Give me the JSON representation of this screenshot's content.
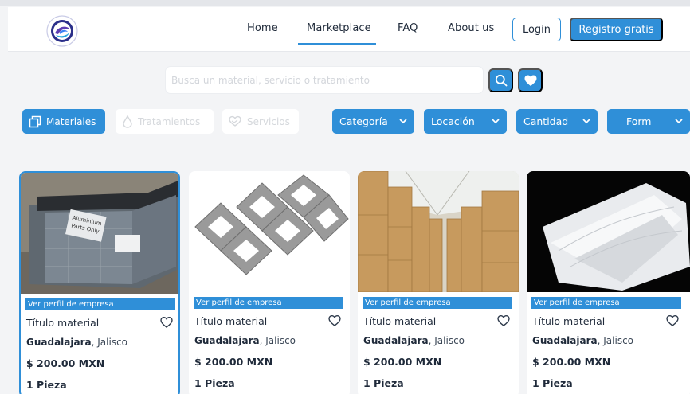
{
  "nav": {
    "items": [
      {
        "label": "Home"
      },
      {
        "label": "Marketplace",
        "active": true
      },
      {
        "label": "FAQ"
      },
      {
        "label": "About us"
      }
    ],
    "login_label": "Login",
    "register_label": "Registro gratis"
  },
  "search": {
    "placeholder": "Busca un material, servicio o tratamiento",
    "search_icon": "search-icon",
    "favorites_icon": "heart-icon"
  },
  "filters": {
    "types": [
      {
        "label": "Materiales",
        "icon": "copy-icon",
        "active": true
      },
      {
        "label": "Tratamientos",
        "icon": "drop-icon",
        "active": false
      },
      {
        "label": "Servicios",
        "icon": "heart-hand-icon",
        "active": false
      }
    ],
    "dropdowns": [
      {
        "label": "Categoría"
      },
      {
        "label": "Locación"
      },
      {
        "label": "Cantidad"
      },
      {
        "label": "Form"
      }
    ]
  },
  "cards": [
    {
      "profile_label": "Ver perfil de empresa",
      "title": "Título material",
      "city": "Guadalajara",
      "state": ", Jalisco",
      "price": "$ 200.00",
      "currency": "MXN",
      "quantity": "1 Pieza",
      "image_text": "Aluminium Parts Only..."
    },
    {
      "profile_label": "Ver perfil de empresa",
      "title": "Título material",
      "city": "Guadalajara",
      "state": ", Jalisco",
      "price": "$ 200.00",
      "currency": "MXN",
      "quantity": "1 Pieza"
    },
    {
      "profile_label": "Ver perfil de empresa",
      "title": "Título material",
      "city": "Guadalajara",
      "state": ", Jalisco",
      "price": "$ 200.00",
      "currency": "MXN",
      "quantity": "1 Pieza"
    },
    {
      "profile_label": "Ver perfil de empresa",
      "title": "Título material",
      "city": "Guadalajara",
      "state": ", Jalisco",
      "price": "$ 200.00",
      "currency": "MXN",
      "quantity": "1 Pieza"
    }
  ],
  "colors": {
    "accent": "#2f8fd8",
    "background": "#f3f4f6",
    "text": "#1f2a3a"
  }
}
